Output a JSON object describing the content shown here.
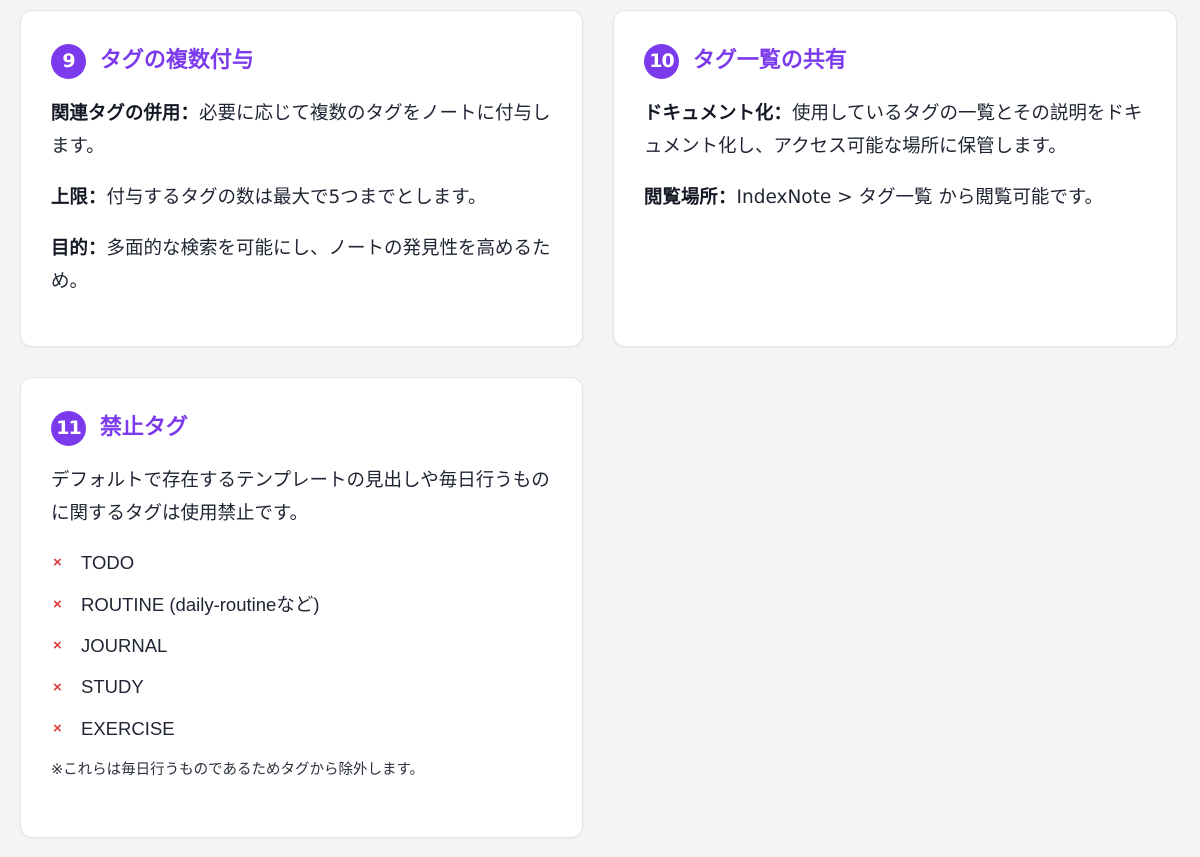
{
  "cards": [
    {
      "number": "9",
      "title": "タグの複数付与",
      "items": [
        {
          "label": "関連タグの併用：",
          "text": "必要に応じて複数のタグをノートに付与します。"
        },
        {
          "label": "上限：",
          "text": "付与するタグの数は最大で5つまでとします。"
        },
        {
          "label": "目的：",
          "text": "多面的な検索を可能にし、ノートの発見性を高めるため。"
        }
      ]
    },
    {
      "number": "10",
      "title": "タグ一覧の共有",
      "items": [
        {
          "label": "ドキュメント化：",
          "text": "使用しているタグの一覧とその説明をドキュメント化し、アクセス可能な場所に保管します。"
        },
        {
          "label": "閲覧場所：",
          "text": "IndexNote > タグ一覧 から閲覧可能です。"
        }
      ]
    },
    {
      "number": "11",
      "title": "禁止タグ",
      "intro": "デフォルトで存在するテンプレートの見出しや毎日行うものに関するタグは使用禁止です。",
      "banned_tags": [
        "TODO",
        "ROUTINE (daily-routineなど)",
        "JOURNAL",
        "STUDY",
        "EXERCISE"
      ],
      "ban_icon": "×",
      "footnote": "※これらは毎日行うものであるためタグから除外します。"
    }
  ],
  "colors": {
    "accent": "#7c3aed",
    "ban_icon": "#dc3c3c",
    "background": "#f4f4f6",
    "card": "#ffffff"
  }
}
